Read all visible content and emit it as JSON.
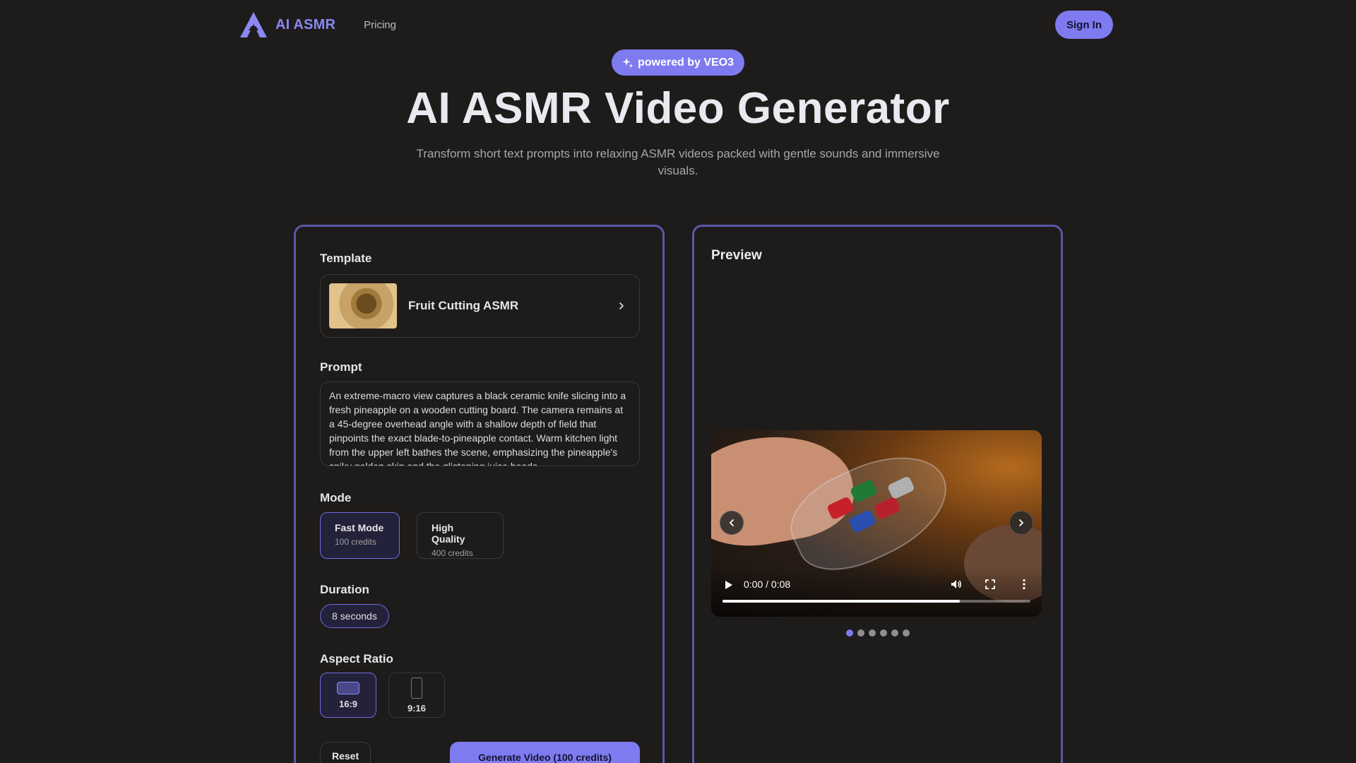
{
  "nav": {
    "brand": "AI ASMR",
    "links": [
      "Pricing"
    ],
    "signin_label": "Sign In"
  },
  "hero": {
    "badge": "powered by VEO3",
    "title": "AI ASMR Video Generator",
    "subtitle": "Transform short text prompts into relaxing ASMR videos packed with gentle sounds and immersive visuals."
  },
  "form": {
    "template_label": "Template",
    "template_name": "Fruit Cutting ASMR",
    "prompt_label": "Prompt",
    "prompt_text": "An extreme-macro view captures a black ceramic knife slicing into a fresh pineapple on a wooden cutting board. The camera remains at a 45-degree overhead angle with a shallow depth of field that pinpoints the exact blade-to-pineapple contact. Warm kitchen light from the upper left bathes the scene, emphasizing the pineapple's spiky golden skin and the glistening juice beads",
    "mode_label": "Mode",
    "modes": [
      {
        "title": "Fast Mode",
        "credits": "100 credits"
      },
      {
        "title": "High Quality",
        "credits": "400 credits"
      }
    ],
    "duration_label": "Duration",
    "duration_value": "8 seconds",
    "aspect_label": "Aspect Ratio",
    "aspect_ratios": [
      "16:9",
      "9:16"
    ],
    "reset_label": "Reset",
    "generate_label": "Generate Video (100 credits)"
  },
  "preview": {
    "title": "Preview",
    "time": "0:00 / 0:08",
    "progress": 0.77,
    "slide_count": 6,
    "active_slide": 0
  },
  "colors": {
    "accent": "#7e7bf0",
    "background": "#1e1b1b",
    "card_border": "#5a58a8"
  }
}
